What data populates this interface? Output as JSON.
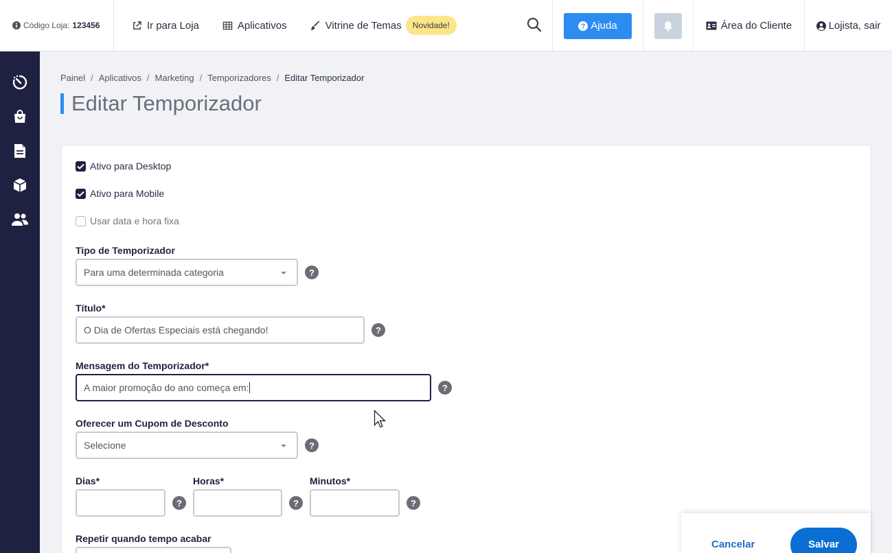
{
  "topbar": {
    "store_code_label": "Código Loja:",
    "store_code_value": "123456",
    "nav": [
      {
        "label": "Ir para Loja",
        "icon": "external-link-icon"
      },
      {
        "label": "Aplicativos",
        "icon": "grid-icon"
      },
      {
        "label": "Vitrine de Temas",
        "icon": "brush-icon"
      }
    ],
    "new_badge": "Novidade!",
    "help_label": "Ajuda",
    "client_area_label": "Área do Cliente",
    "logout_label": "Lojista, sair"
  },
  "sidebar": {
    "items": [
      {
        "icon": "dashboard-speed-icon"
      },
      {
        "icon": "shopping-bag-icon"
      },
      {
        "icon": "document-icon"
      },
      {
        "icon": "box-icon"
      },
      {
        "icon": "users-icon"
      }
    ]
  },
  "breadcrumb": [
    "Painel",
    "Aplicativos",
    "Marketing",
    "Temporizadores",
    "Editar Temporizador"
  ],
  "page_title": "Editar Temporizador",
  "form": {
    "active_desktop": {
      "label": "Ativo para Desktop",
      "checked": true
    },
    "active_mobile": {
      "label": "Ativo para Mobile",
      "checked": true
    },
    "fixed_datetime": {
      "label": "Usar data e hora fixa",
      "checked": false
    },
    "timer_type": {
      "label": "Tipo de Temporizador",
      "value": "Para uma determinada categoria"
    },
    "title": {
      "label": "Título*",
      "value": "O Dia de Ofertas Especiais está chegando!"
    },
    "message": {
      "label": "Mensagem do Temporizador*",
      "value": "A maior promoção do ano começa em:"
    },
    "coupon": {
      "label": "Oferecer um Cupom de Desconto",
      "value": "Selecione"
    },
    "days": {
      "label": "Dias*",
      "value": ""
    },
    "hours": {
      "label": "Horas*",
      "value": ""
    },
    "minutes": {
      "label": "Minutos*",
      "value": ""
    },
    "repeat": {
      "label": "Repetir quando tempo acabar"
    }
  },
  "actions": {
    "cancel_label": "Cancelar",
    "save_label": "Salvar"
  },
  "colors": {
    "accent": "#2d8cf0",
    "sidebar": "#1f2141",
    "save": "#0b6ed3",
    "badge": "#fde68a"
  }
}
